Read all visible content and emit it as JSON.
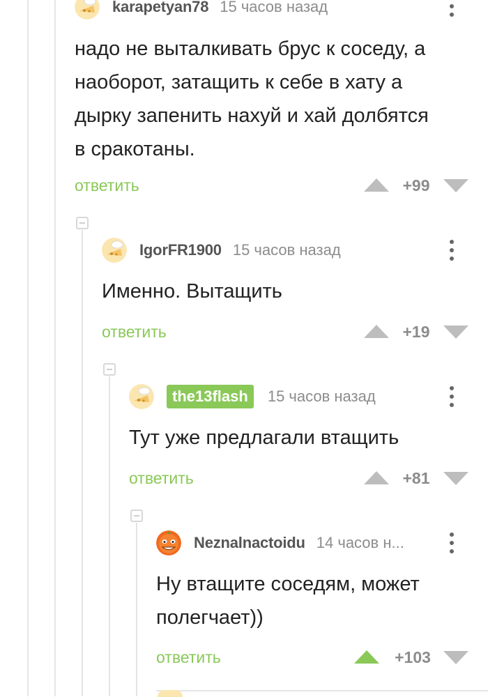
{
  "comments": [
    {
      "username": "karapetyan78",
      "time": "15 часов назад",
      "lines": [
        "надо не выталкивать брус к соседу, а",
        "наоборот, затащить к себе в хату а",
        "дырку запенить нахуй и хай долбятся",
        "в сракотаны."
      ],
      "reply_label": "ответить",
      "rating": "+99",
      "avatar_icon": "default-cheese-avatar"
    },
    {
      "username": "IgorFR1900",
      "time": "15 часов назад",
      "lines": [
        "Именно. Вытащить"
      ],
      "reply_label": "ответить",
      "rating": "+19",
      "avatar_icon": "default-cheese-avatar"
    },
    {
      "username": "the13flash",
      "is_author": true,
      "time": "15 часов назад",
      "lines": [
        "Тут уже предлагали втащить"
      ],
      "reply_label": "ответить",
      "rating": "+81",
      "avatar_icon": "default-cheese-avatar"
    },
    {
      "username": "Neznalnactoidu",
      "time": "14 часов н...",
      "lines": [
        "Ну втащите соседям, может",
        "полегчает))"
      ],
      "reply_label": "ответить",
      "rating": "+103",
      "upvoted": true,
      "avatar_icon": "orange-face-avatar"
    }
  ],
  "colors": {
    "accent": "#8ac858",
    "muted": "#8c8c8c",
    "vote_inactive": "#bdbdbd",
    "thread_line": "#e5e5e5"
  }
}
